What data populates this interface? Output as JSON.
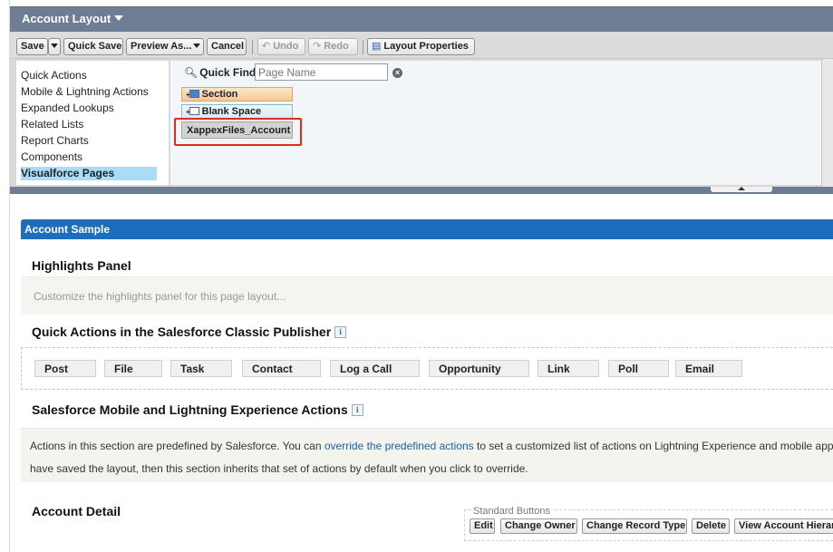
{
  "header": {
    "title": "Account Layout"
  },
  "toolbar": {
    "save": "Save",
    "quick_save": "Quick Save",
    "preview_as": "Preview As...",
    "cancel": "Cancel",
    "undo": "Undo",
    "redo": "Redo",
    "layout_properties": "Layout Properties"
  },
  "palette": {
    "categories": [
      "Quick Actions",
      "Mobile & Lightning Actions",
      "Expanded Lookups",
      "Related Lists",
      "Report Charts",
      "Components",
      "Visualforce Pages"
    ],
    "selected_category": "Visualforce Pages",
    "quick_find_label": "Quick Find",
    "quick_find_placeholder": "Page Name",
    "items": [
      "Section",
      "Blank Space",
      "XappexFiles_Account"
    ]
  },
  "layout": {
    "page_header": "Account Sample",
    "highlights": {
      "title": "Highlights Panel",
      "placeholder": "Customize the highlights panel for this page layout..."
    },
    "quick_actions": {
      "title": "Quick Actions in the Salesforce Classic Publisher",
      "actions": [
        "Post",
        "File",
        "Task",
        "Contact",
        "Log a Call",
        "Opportunity",
        "Link",
        "Poll",
        "Email"
      ]
    },
    "mobile_actions": {
      "title": "Salesforce Mobile and Lightning Experience Actions",
      "text_before": "Actions in this section are predefined by Salesforce. You can ",
      "link": "override the predefined actions",
      "text_after": " to set a customized list of actions on Lightning Experience and mobile app",
      "line2": "have saved the layout, then this section inherits that set of actions by default when you click to override."
    },
    "account_detail": {
      "title": "Account Detail",
      "standard_buttons_label": "Standard Buttons",
      "buttons": [
        "Edit",
        "Change Owner",
        "Change Record Type",
        "Delete",
        "View Account Hierar"
      ]
    }
  },
  "colors": {
    "header_bg": "#6f7d94",
    "section_header": "#1c6ebd",
    "highlight_box": "#e02a1c",
    "selected_category": "#a9dcf7"
  }
}
